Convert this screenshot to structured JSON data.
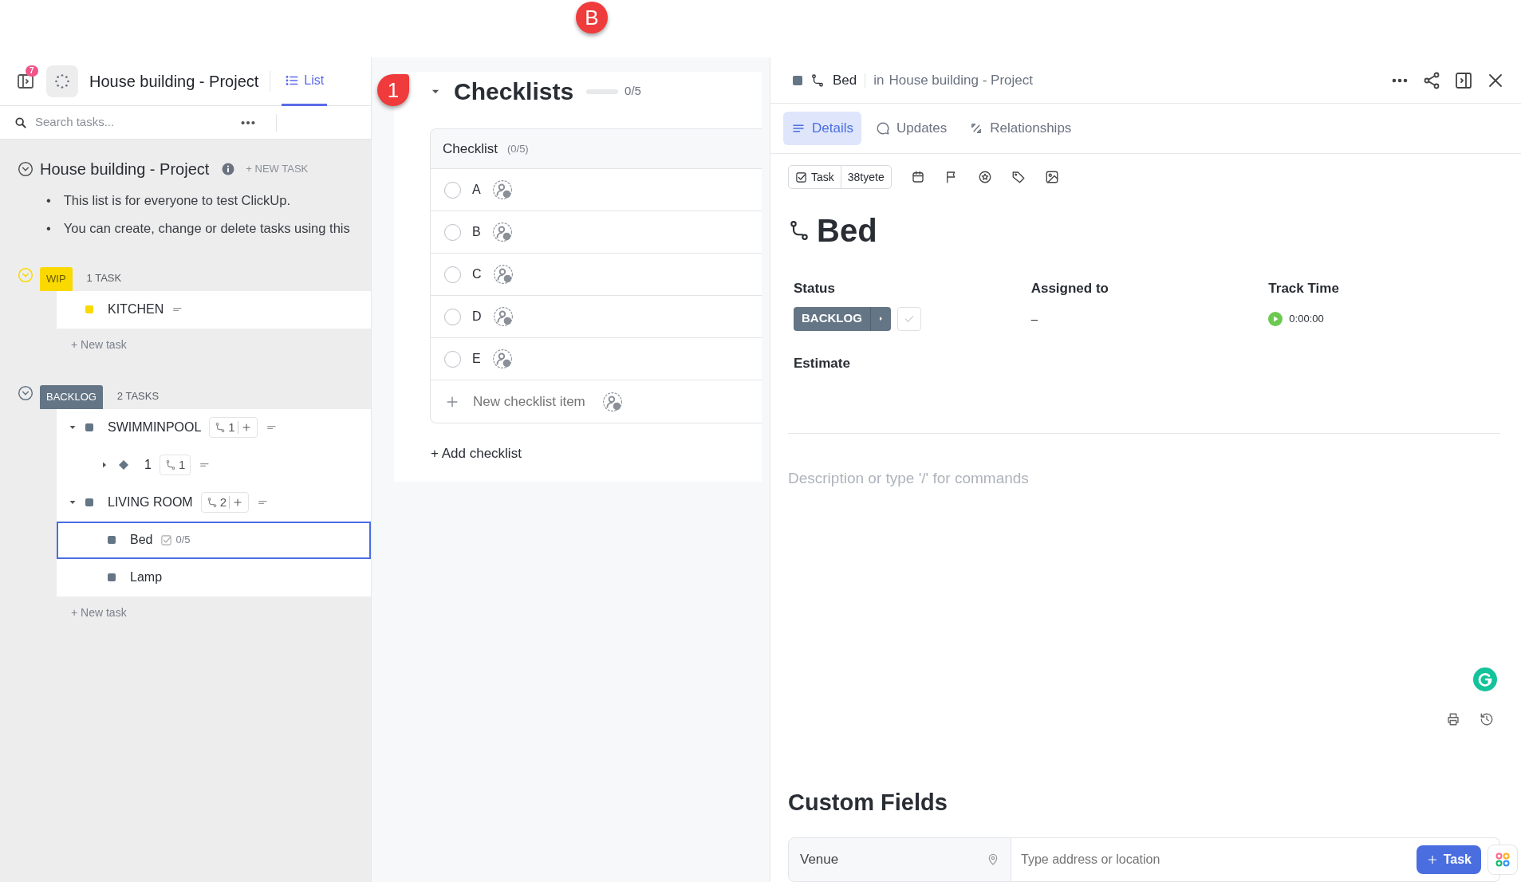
{
  "annotations": [
    {
      "label": "B"
    },
    {
      "label": "1"
    }
  ],
  "list_header": {
    "notification_count": "7",
    "title": "House building - Project",
    "view_tabs": [
      {
        "label": "List",
        "selected": true
      }
    ]
  },
  "search": {
    "placeholder": "Search tasks..."
  },
  "list": {
    "title": "House building - Project",
    "new_task": "+ NEW TASK",
    "description": [
      {
        "bullet": "•",
        "text": "This list is for everyone to test ClickUp."
      },
      {
        "bullet": "•",
        "text": "You can create, change or delete tasks using this"
      }
    ]
  },
  "groups": [
    {
      "status": "WIP",
      "color": "#f9d900",
      "count": "1 TASK",
      "new_task": "+ New task",
      "tasks": [
        {
          "name": "KITCHEN",
          "kind": "task",
          "selected": false
        }
      ]
    },
    {
      "status": "BACKLOG",
      "color": "#647585",
      "count": "2 TASKS",
      "new_task": "+ New task",
      "tasks": [
        {
          "name": "SWIMMINPOOL",
          "kind": "task",
          "selected": false,
          "expanded": true,
          "subtasks": "1",
          "children": [
            {
              "name": "1",
              "kind": "milestone",
              "selected": false,
              "expanded": false,
              "subtasks": "1"
            }
          ]
        },
        {
          "name": "LIVING ROOM",
          "kind": "task",
          "selected": false,
          "expanded": true,
          "subtasks": "2",
          "children": [
            {
              "name": "Bed",
              "kind": "task",
              "selected": true,
              "checklist": "0/5"
            },
            {
              "name": "Lamp",
              "kind": "task",
              "selected": false
            }
          ]
        }
      ]
    }
  ],
  "checklists": {
    "title": "Checklists",
    "expanded": true,
    "level": 0,
    "progress": "0/5",
    "checklist": {
      "name": "Checklist",
      "count": "(0/5)",
      "items": [
        {
          "label": "A",
          "checked": false
        },
        {
          "label": "B",
          "checked": false
        },
        {
          "label": "C",
          "checked": false
        },
        {
          "label": "D",
          "checked": false
        },
        {
          "label": "E",
          "checked": false
        }
      ],
      "new_item_placeholder": "New checklist item"
    },
    "add": "+ Add checklist"
  },
  "detail": {
    "breadcrumb": {
      "task": "Bed",
      "in": "in",
      "list": "House building - Project"
    },
    "tabs": [
      {
        "label": "Details",
        "selected": true
      },
      {
        "label": "Updates",
        "selected": false
      },
      {
        "label": "Relationships",
        "selected": false
      }
    ],
    "type": "Task",
    "id": "38tyete",
    "title": "Bed",
    "fields": [
      {
        "label": "Status",
        "kind": "status",
        "value": "BACKLOG",
        "color": "#647585"
      },
      {
        "label": "Assigned to",
        "kind": "text",
        "value": "–"
      },
      {
        "label": "Track Time",
        "kind": "timer",
        "value": "0:00:00"
      }
    ],
    "estimate": "Estimate",
    "description_placeholder": "Description or type '/' for commands",
    "custom_fields": {
      "title": "Custom Fields",
      "fields": [
        {
          "name": "Venue",
          "placeholder": "Type address or location"
        }
      ]
    },
    "add_button": "Task"
  }
}
